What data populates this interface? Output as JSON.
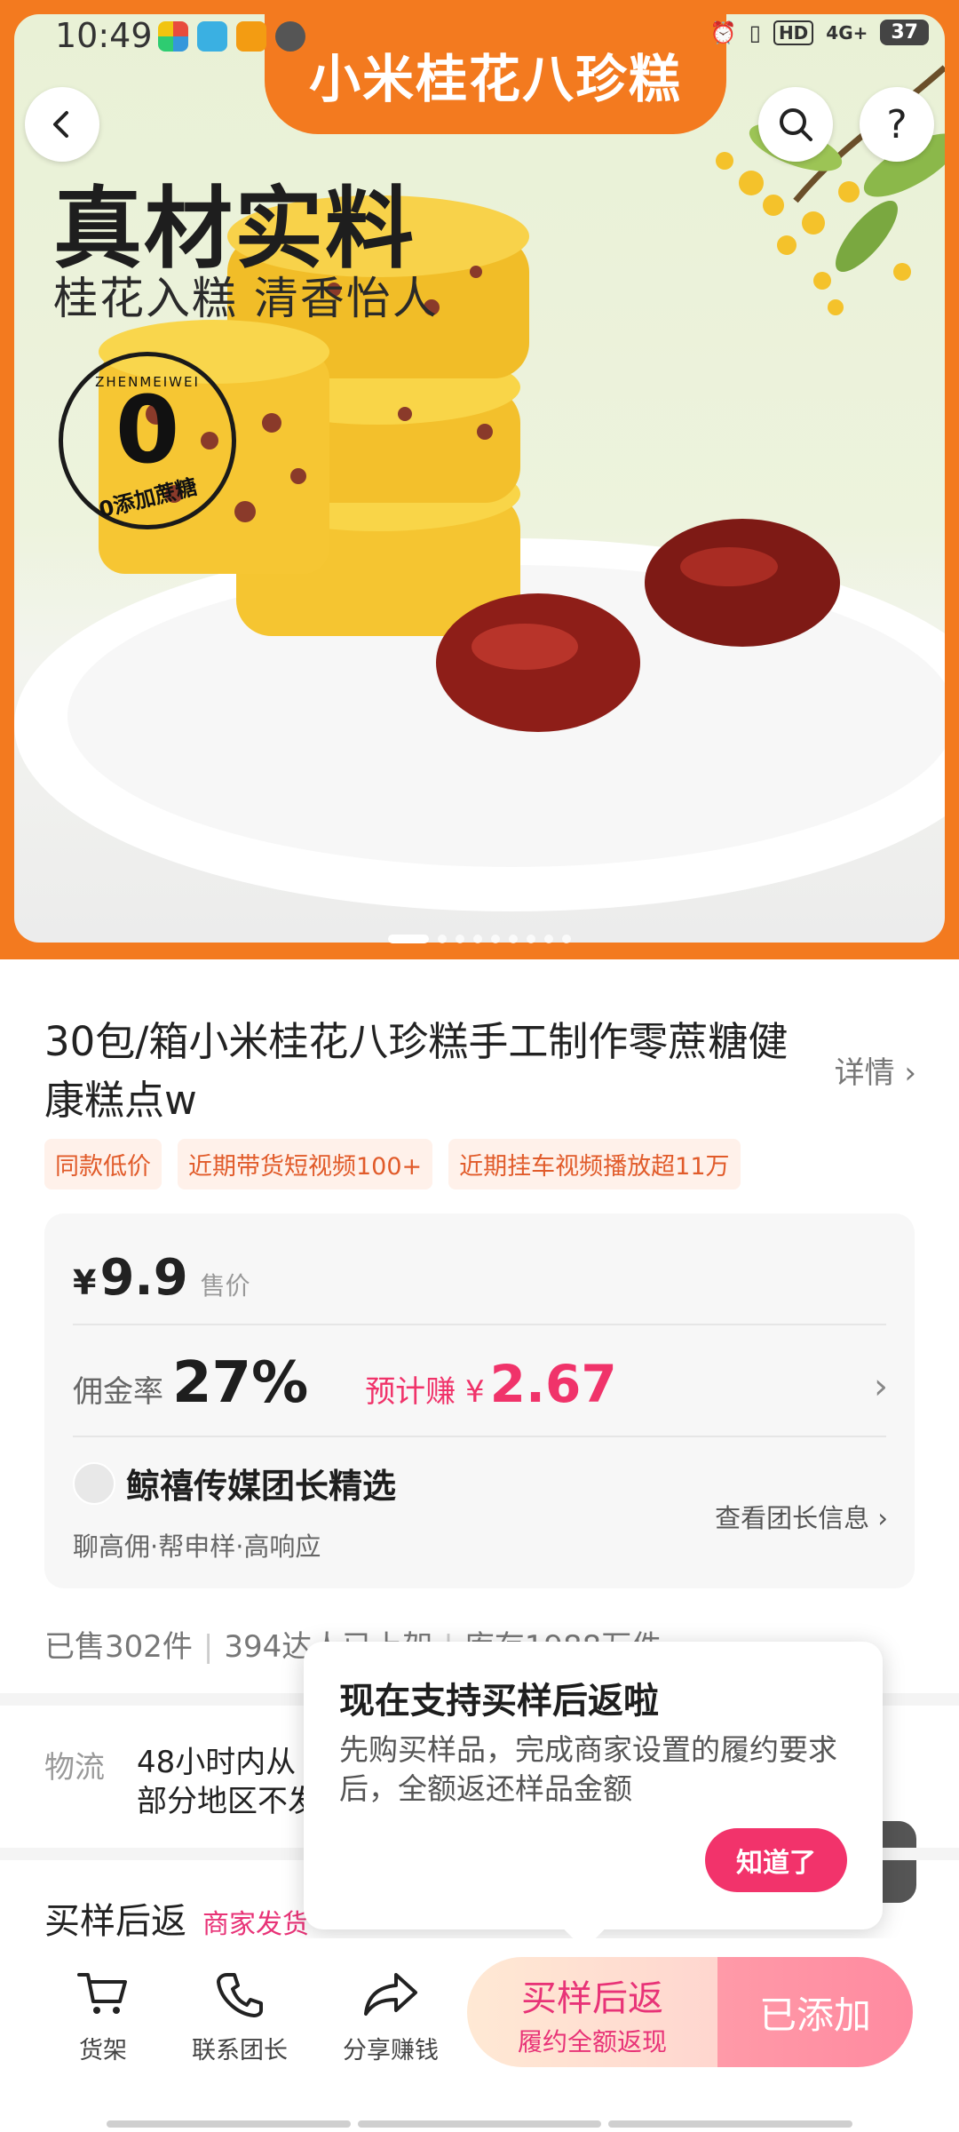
{
  "status_bar": {
    "time": "10:49",
    "network": "4G+",
    "hd": "HD",
    "battery": "37"
  },
  "hero": {
    "banner_title": "小米桂花八珍糕",
    "headline": "真材实料",
    "subline": "桂花入糕 清香怡人",
    "seal_top": "ZHENMEIWEI",
    "seal_center": "0",
    "seal_bottom": "0添加蔗糖",
    "pager_count": 9,
    "pager_active": 0
  },
  "product": {
    "title": "30包/箱小米桂花八珍糕手工制作零蔗糖健康糕点w",
    "detail_link": "详情",
    "tags": [
      "同款低价",
      "近期带货短视频100+",
      "近期挂车视频播放超11万"
    ]
  },
  "price_card": {
    "currency": "¥",
    "price": "9.9",
    "price_label": "售价",
    "commission_label": "佣金率",
    "commission_rate": "27%",
    "earn_label": "预计赚 ¥",
    "earn_value": "2.67",
    "leader_name": "鲸禧传媒团长精选",
    "leader_sub": "聊高佣·帮申样·高响应",
    "leader_link": "查看团长信息"
  },
  "stats": {
    "sold": "已售302件",
    "partial": "394达人已上架",
    "stock": "库存1988万件"
  },
  "logistics": {
    "label": "物流",
    "line1": "48小时内从",
    "line2": "部分地区不发"
  },
  "sample_return": {
    "title": "买样后返",
    "subtitle": "商家发货"
  },
  "popup": {
    "title": "现在支持买样后返啦",
    "body": "先购买样品，完成商家设置的履约要求后，全额返还样品金额",
    "button": "知道了"
  },
  "bottom_bar": {
    "cart_label": "货架",
    "call_label": "联系团长",
    "share_label": "分享赚钱",
    "cta_main": "买样后返",
    "cta_sub": "履约全额返现",
    "cta_added": "已添加"
  },
  "colors": {
    "brand_orange": "#f37a1f",
    "accent_pink": "#f0336a",
    "tag_text": "#e15b2a"
  }
}
